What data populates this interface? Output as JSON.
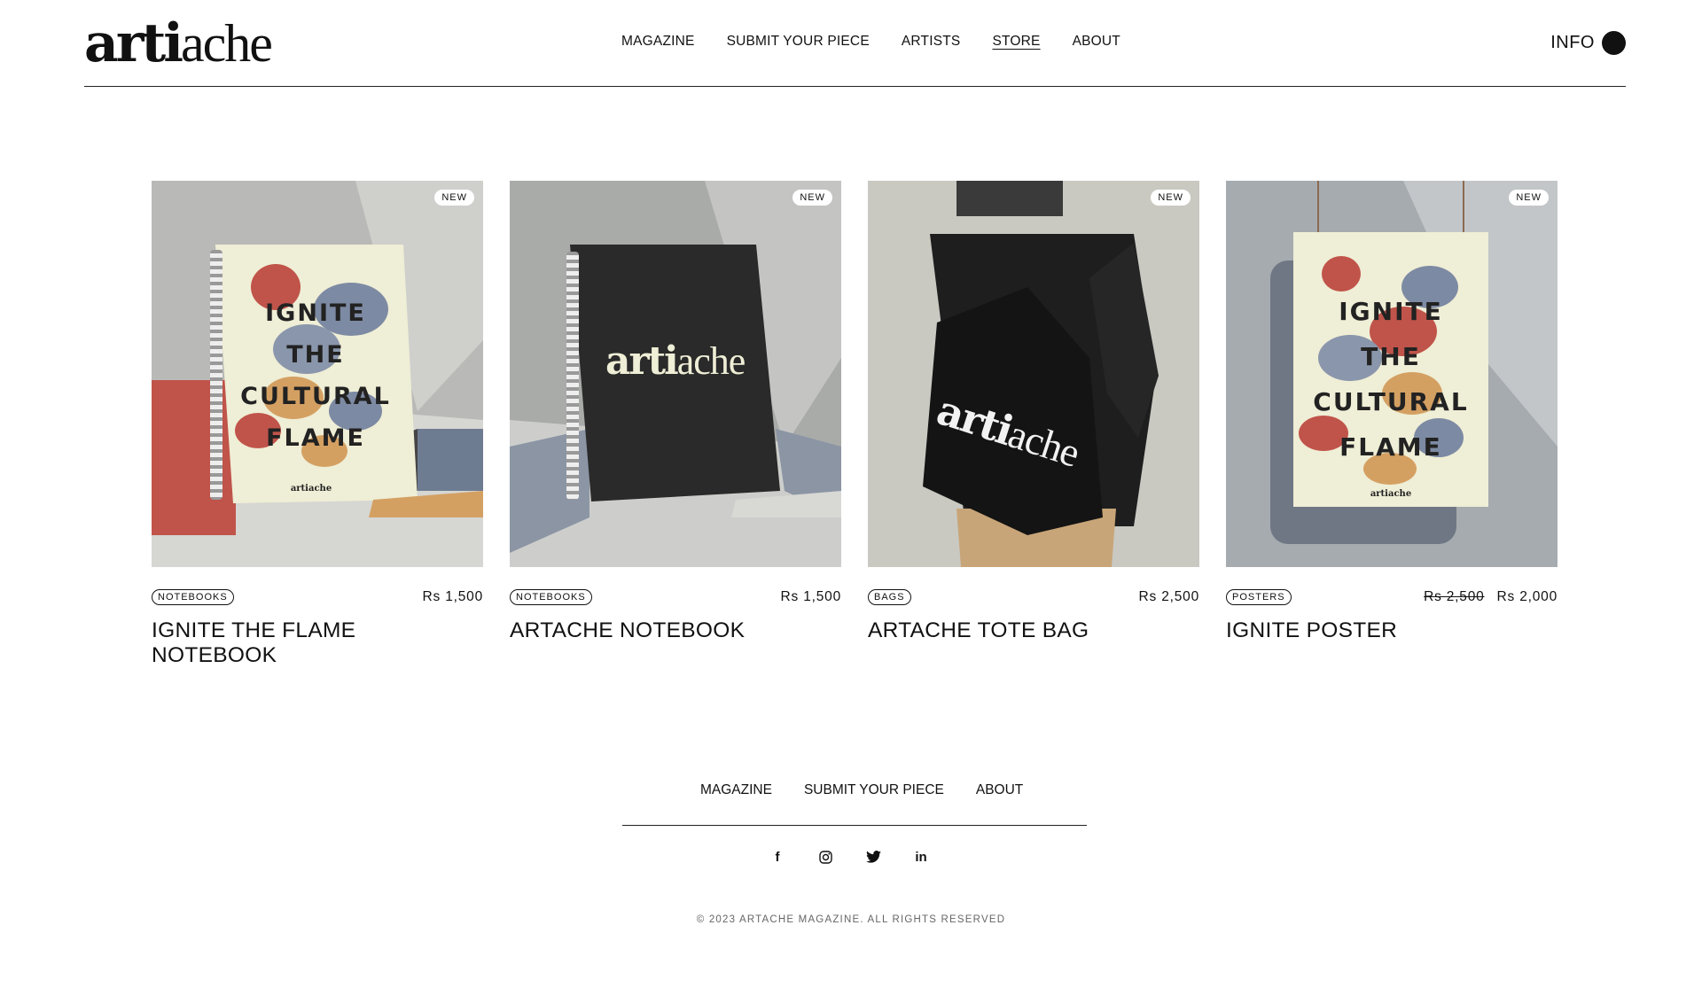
{
  "header": {
    "logo_bold": "arti",
    "logo_light": "ache",
    "nav": [
      "MAGAZINE",
      "SUBMIT YOUR PIECE",
      "ARTISTS",
      "STORE",
      "ABOUT"
    ],
    "active_nav": "STORE",
    "info_label": "INFO"
  },
  "products": [
    {
      "badge": "NEW",
      "category": "NOTEBOOKS",
      "price": "Rs 1,500",
      "old_price": "",
      "name": "IGNITE THE FLAME NOTEBOOK",
      "cover_text": [
        "IGNITE",
        "THE",
        "CULTURAL",
        "FLAME"
      ]
    },
    {
      "badge": "NEW",
      "category": "NOTEBOOKS",
      "price": "Rs 1,500",
      "old_price": "",
      "name": "ARTACHE NOTEBOOK",
      "cover_logo_bold": "arti",
      "cover_logo_light": "ache"
    },
    {
      "badge": "NEW",
      "category": "BAGS",
      "price": "Rs 2,500",
      "old_price": "",
      "name": "ARTACHE TOTE BAG",
      "cover_logo_bold": "arti",
      "cover_logo_light": "ache"
    },
    {
      "badge": "NEW",
      "category": "POSTERS",
      "price": "Rs 2,000",
      "old_price": "Rs 2,500",
      "name": "IGNITE POSTER",
      "cover_text": [
        "IGNITE",
        "THE",
        "CULTURAL",
        "FLAME"
      ]
    }
  ],
  "footer": {
    "nav": [
      "MAGAZINE",
      "SUBMIT YOUR PIECE",
      "ABOUT"
    ],
    "social": [
      {
        "icon": "facebook-icon",
        "glyph": "f"
      },
      {
        "icon": "instagram-icon",
        "glyph": "◎"
      },
      {
        "icon": "twitter-icon",
        "glyph": "🐦"
      },
      {
        "icon": "linkedin-icon",
        "glyph": "in"
      }
    ],
    "copyright": "© 2023 ARTACHE MAGAZINE. ALL RIGHTS RESERVED"
  },
  "colors": {
    "text": "#111111",
    "muted": "#666666",
    "accent_red": "#c0544a",
    "accent_tan": "#d4a062",
    "accent_blue": "#7d8aa3",
    "cream": "#efeed6"
  }
}
